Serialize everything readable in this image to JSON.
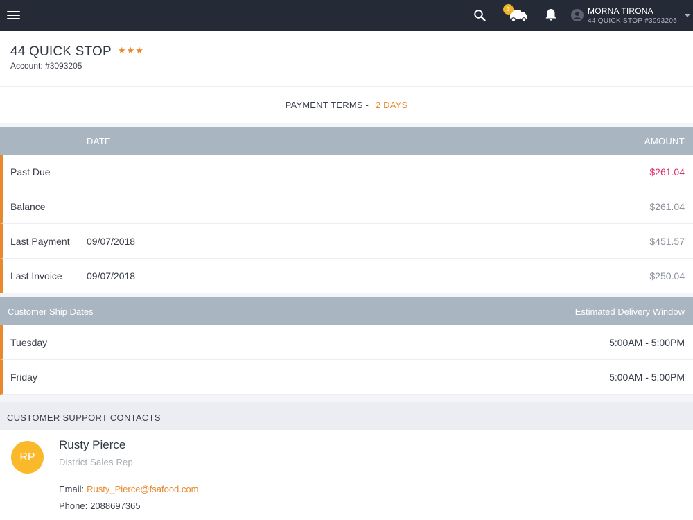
{
  "topbar": {
    "truck_badge": "3",
    "user_name": "MORNA TIRONA",
    "user_account": "44 QUICK STOP #3093205",
    "icons": [
      "menu-icon",
      "search-icon",
      "truck-icon",
      "bell-icon",
      "user-icon",
      "caret-down-icon"
    ]
  },
  "store": {
    "title": "44 QUICK STOP",
    "stars": "★★★",
    "account": "Account: #3093205"
  },
  "payment_terms": {
    "label": "PAYMENT TERMS -",
    "value": "2 DAYS"
  },
  "billing_table": {
    "headers": {
      "date": "DATE",
      "amount": "AMOUNT"
    },
    "rows": [
      {
        "label": "Past Due",
        "date": "",
        "amount": "$261.04"
      },
      {
        "label": "Balance",
        "date": "",
        "amount": "$261.04"
      },
      {
        "label": "Last Payment",
        "date": "09/07/2018",
        "amount": "$451.57"
      },
      {
        "label": "Last Invoice",
        "date": "09/07/2018",
        "amount": "$250.04"
      }
    ]
  },
  "ship_table": {
    "headers": {
      "left": "Customer Ship Dates",
      "right": "Estimated Delivery Window"
    },
    "rows": [
      {
        "day": "Tuesday",
        "window": "5:00AM - 5:00PM"
      },
      {
        "day": "Friday",
        "window": "5:00AM - 5:00PM"
      }
    ]
  },
  "support": {
    "heading": "CUSTOMER SUPPORT CONTACTS",
    "contacts": [
      {
        "initials": "RP",
        "name": "Rusty Pierce",
        "role": "District Sales Rep",
        "email_label": "Email:",
        "email": "Rusty_Pierce@fsafood.com",
        "phone_label": "Phone:",
        "phone": "2088697365"
      }
    ]
  },
  "colors": {
    "topbar": "#252b36",
    "accent": "#e8892d",
    "past_due": "#e0306a",
    "table_header": "#a9b6c1",
    "avatar": "#f9b92a"
  }
}
